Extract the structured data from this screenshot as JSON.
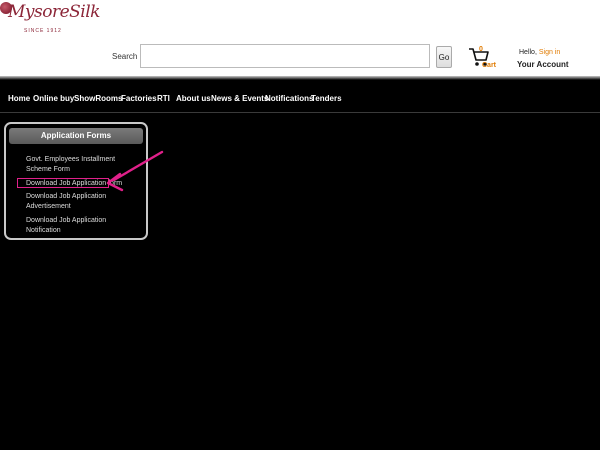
{
  "brand": {
    "name": "MysoreSilk",
    "tagline": "SINCE 1912"
  },
  "search": {
    "label": "Search",
    "value": "",
    "go_label": "Go"
  },
  "cart": {
    "count": "0",
    "label": "Cart"
  },
  "account": {
    "hello": "Hello,",
    "sign_in": "Sign in",
    "your_account": "Your Account"
  },
  "nav": {
    "items": [
      "Home",
      "Online buy",
      "ShowRooms",
      "Factories",
      "RTI",
      "About us",
      "News & Events",
      "Notifications",
      "Tenders"
    ]
  },
  "panel": {
    "title": "Application Forms",
    "links": [
      "Govt. Employees Installment Scheme Form",
      "Download Job Application form",
      "Download Job Application Advertisement",
      "Download Job Application Notification"
    ]
  },
  "annotation": {
    "color": "#e0208a"
  }
}
